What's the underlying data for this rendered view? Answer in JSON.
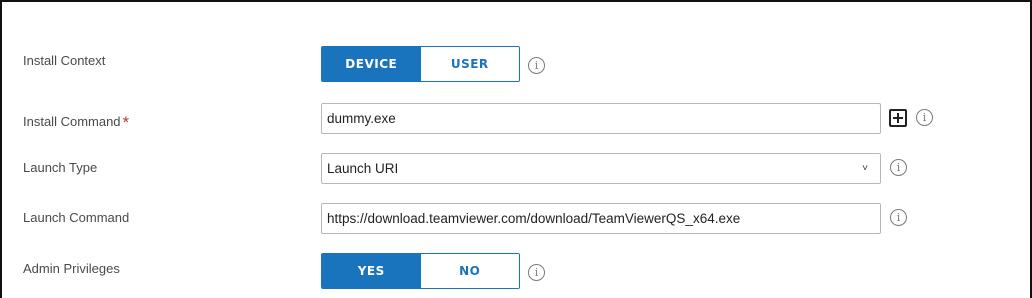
{
  "install_context": {
    "label": "Install Context",
    "options": [
      "DEVICE",
      "USER"
    ],
    "selected": "DEVICE"
  },
  "install_command": {
    "label": "Install Command",
    "required_marker": "*",
    "value": "dummy.exe"
  },
  "launch_type": {
    "label": "Launch Type",
    "selected_value": "Launch URI",
    "chevron": "˅"
  },
  "launch_command": {
    "label": "Launch Command",
    "value": "https://download.teamviewer.com/download/TeamViewerQS_x64.exe"
  },
  "admin_privileges": {
    "label": "Admin Privileges",
    "options": [
      "YES",
      "NO"
    ],
    "selected": "YES"
  },
  "info_glyph": "i",
  "accent_color": "#1a73bd",
  "required_color": "#c0392b"
}
